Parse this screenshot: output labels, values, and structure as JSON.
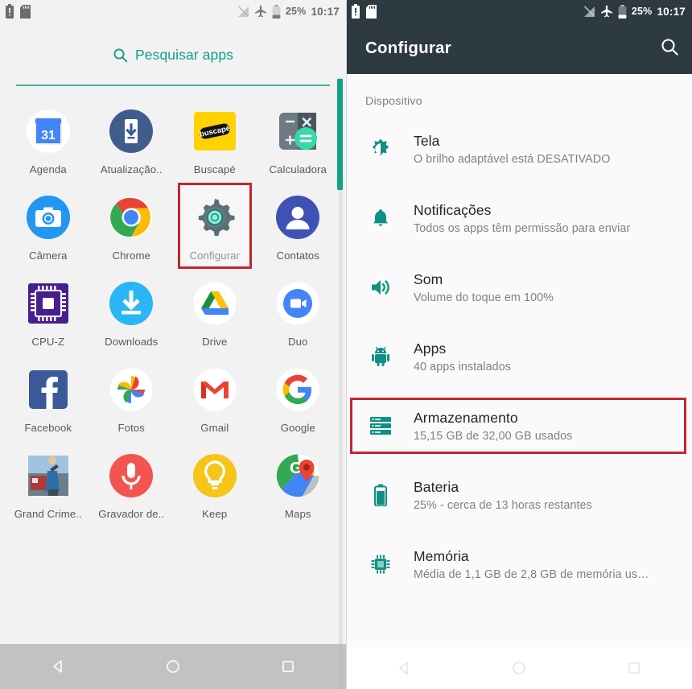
{
  "left": {
    "status_bar": {
      "icons_left": [
        "battery-alert-icon",
        "sd-card-icon"
      ],
      "icons_right": [
        "no-sim-icon",
        "airplane-mode-icon",
        "battery-icon"
      ],
      "battery_percent": "25%",
      "time": "10:17"
    },
    "search": {
      "label": "Pesquisar apps",
      "icon": "search-icon",
      "accent_color": "#119e8e"
    },
    "apps": [
      {
        "label": "Agenda",
        "icon": "calendar-icon",
        "day": "31"
      },
      {
        "label": "Atualização..",
        "icon": "system-update-icon"
      },
      {
        "label": "Buscapé",
        "icon": "buscape-icon",
        "badge_text": "buscapé"
      },
      {
        "label": "Calculadora",
        "icon": "calculator-icon",
        "keys": [
          "−",
          "×",
          "+",
          "="
        ]
      },
      {
        "label": "Câmera",
        "icon": "camera-icon"
      },
      {
        "label": "Chrome",
        "icon": "chrome-icon"
      },
      {
        "label": "Configurar",
        "icon": "settings-gear-icon",
        "highlighted": true
      },
      {
        "label": "Contatos",
        "icon": "contacts-icon"
      },
      {
        "label": "CPU-Z",
        "icon": "cpu-chip-icon"
      },
      {
        "label": "Downloads",
        "icon": "download-icon"
      },
      {
        "label": "Drive",
        "icon": "google-drive-icon"
      },
      {
        "label": "Duo",
        "icon": "google-duo-icon"
      },
      {
        "label": "Facebook",
        "icon": "facebook-icon"
      },
      {
        "label": "Fotos",
        "icon": "google-photos-icon"
      },
      {
        "label": "Gmail",
        "icon": "gmail-icon"
      },
      {
        "label": "Google",
        "icon": "google-icon"
      },
      {
        "label": "Grand Crime..",
        "icon": "grand-crime-game-icon"
      },
      {
        "label": "Gravador de..",
        "icon": "voice-recorder-icon"
      },
      {
        "label": "Keep",
        "icon": "google-keep-icon"
      },
      {
        "label": "Maps",
        "icon": "google-maps-icon"
      }
    ],
    "nav_bar": {
      "back": "back-nav-icon",
      "home": "home-nav-icon",
      "recents": "recents-nav-icon"
    }
  },
  "right": {
    "status_bar": {
      "battery_percent": "25%",
      "time": "10:17"
    },
    "app_bar": {
      "title": "Configurar",
      "search_icon": "search-icon"
    },
    "section_title": "Dispositivo",
    "settings": [
      {
        "title": "Tela",
        "subtitle": "O brilho adaptável está DESATIVADO",
        "icon": "brightness-icon",
        "highlighted": false
      },
      {
        "title": "Notificações",
        "subtitle": "Todos os apps têm permissão para enviar",
        "icon": "bell-icon",
        "highlighted": false
      },
      {
        "title": "Som",
        "subtitle": "Volume do toque em 100%",
        "icon": "volume-icon",
        "highlighted": false
      },
      {
        "title": "Apps",
        "subtitle": "40 apps instalados",
        "icon": "android-robot-icon",
        "highlighted": false
      },
      {
        "title": "Armazenamento",
        "subtitle": "15,15 GB de 32,00 GB usados",
        "icon": "storage-icon",
        "highlighted": true
      },
      {
        "title": "Bateria",
        "subtitle": "25% - cerca de 13 horas restantes",
        "icon": "battery-icon",
        "highlighted": false
      },
      {
        "title": "Memória",
        "subtitle": "Média de 1,1 GB de 2,8 GB de memória us…",
        "icon": "memory-chip-icon",
        "highlighted": false
      }
    ],
    "nav_bar": {
      "back": "back-nav-icon",
      "home": "home-nav-icon",
      "recents": "recents-nav-icon"
    }
  },
  "colors": {
    "accent_teal": "#0e9184",
    "highlight_red": "#c1272d",
    "appbar_dark": "#2e3a42"
  }
}
